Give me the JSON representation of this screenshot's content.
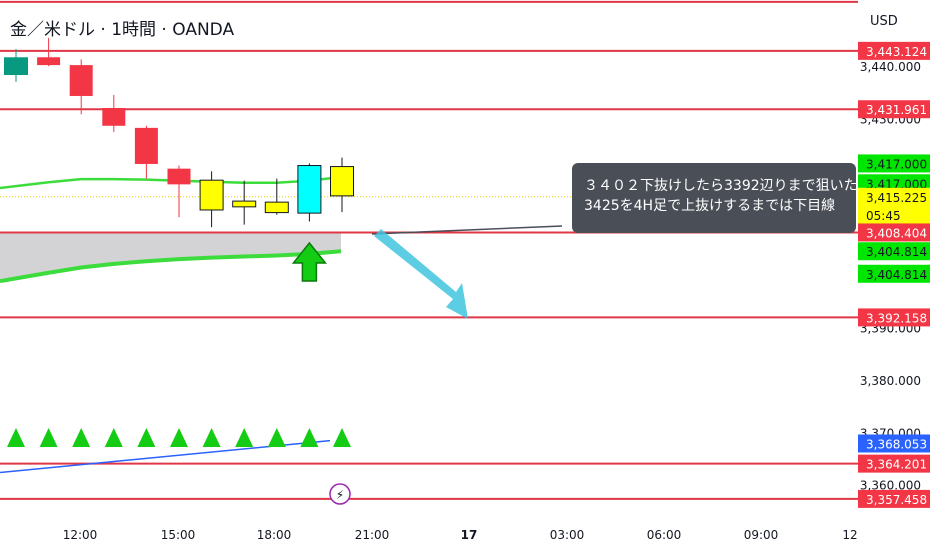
{
  "header": {
    "title": "金／米ドル · 1時間 · OANDA",
    "currency": "USD"
  },
  "annotation": {
    "line1": "３４０２下抜けしたら3392辺りまで狙いた",
    "line2": "3425を4H足で上抜けするまでは下目線"
  },
  "colors": {
    "bull": "#089981",
    "bear": "#f23645",
    "hline": "#e03746",
    "band_fill": "#d3d3d5",
    "band_line": "#3ddc3d",
    "up_marker": "#14cc14",
    "ma": "#2962ff",
    "arrow": "#40c4dd",
    "annotation_bg": "#4a4e57"
  },
  "chart_data": {
    "type": "candlestick",
    "price_axis": {
      "ticks": [
        "3,440.000",
        "3,430.000",
        "3,390.000",
        "3,380.000",
        "3,370.000",
        "3,360.000"
      ]
    },
    "time_axis": {
      "ticks": [
        "12:00",
        "15:00",
        "18:00",
        "21:00",
        "17",
        "03:00",
        "06:00",
        "09:00",
        "12"
      ]
    },
    "candles": [
      {
        "open": 3438.6,
        "high": 3443.5,
        "low": 3437.2,
        "close": 3441.8,
        "color": "teal"
      },
      {
        "open": 3441.9,
        "high": 3445.6,
        "low": 3440.2,
        "close": 3440.4,
        "color": "red"
      },
      {
        "open": 3440.4,
        "high": 3441.5,
        "low": 3431.0,
        "close": 3434.5,
        "color": "red"
      },
      {
        "open": 3432.2,
        "high": 3434.7,
        "low": 3427.6,
        "close": 3428.8,
        "color": "red"
      },
      {
        "open": 3428.4,
        "high": 3428.8,
        "low": 3418.7,
        "close": 3421.5,
        "color": "red"
      },
      {
        "open": 3420.6,
        "high": 3421.2,
        "low": 3411.3,
        "close": 3417.6,
        "color": "red"
      },
      {
        "open": 3418.4,
        "high": 3420.1,
        "low": 3409.4,
        "close": 3412.7,
        "color": "yellow"
      },
      {
        "open": 3414.4,
        "high": 3418.3,
        "low": 3409.9,
        "close": 3413.3,
        "color": "yellow"
      },
      {
        "open": 3414.2,
        "high": 3418.7,
        "low": 3411.8,
        "close": 3412.2,
        "color": "yellow"
      },
      {
        "open": 3421.2,
        "high": 3421.6,
        "low": 3410.5,
        "close": 3412.1,
        "color": "cyan"
      },
      {
        "open": 3415.4,
        "high": 3422.7,
        "low": 3412.3,
        "close": 3421.0,
        "color": "yellow"
      }
    ],
    "horizontal_lines": [
      3452.5,
      3443.124,
      3431.961,
      3408.404,
      3392.158,
      3364.201,
      3357.458
    ],
    "price_labels": [
      {
        "text": "3,443.124",
        "bg": "#f23645",
        "fg": "#ffffff",
        "price": 3443.124
      },
      {
        "text": "3,431.961",
        "bg": "#f23645",
        "fg": "#ffffff",
        "price": 3431.961
      },
      {
        "text": "3,417.000",
        "bg": "#00e600",
        "fg": "#131722",
        "price": 3421.6
      },
      {
        "text": "3,417.000",
        "bg": "#00e600",
        "fg": "#131722",
        "price": 3417.8
      },
      {
        "text": "3,415.225",
        "bg": "#ffff00",
        "fg": "#131722",
        "price": 3415.225,
        "countdown": "05:45"
      },
      {
        "text": "3,408.404",
        "bg": "#f23645",
        "fg": "#ffffff",
        "price": 3408.404
      },
      {
        "text": "3,404.814",
        "bg": "#00e600",
        "fg": "#131722",
        "price": 3404.814
      },
      {
        "text": "3,404.814",
        "bg": "#00e600",
        "fg": "#131722",
        "price": 3400.5
      },
      {
        "text": "3,392.158",
        "bg": "#f23645",
        "fg": "#ffffff",
        "price": 3392.158
      },
      {
        "text": "3,368.053",
        "bg": "#2962ff",
        "fg": "#ffffff",
        "price": 3368.053
      },
      {
        "text": "3,364.201",
        "bg": "#f23645",
        "fg": "#ffffff",
        "price": 3364.201
      },
      {
        "text": "3,357.458",
        "bg": "#f23645",
        "fg": "#ffffff",
        "price": 3357.458
      }
    ],
    "band": {
      "upper": [
        3416.9,
        3418.0,
        3418.6,
        3418.6,
        3418.5,
        3418.3,
        3418.1,
        3417.9,
        3417.9,
        3418.3,
        3419.0
      ],
      "lower": [
        3399.1,
        3400.7,
        3401.7,
        3402.4,
        3402.9,
        3403.3,
        3403.6,
        3403.8,
        3404.0,
        3404.3,
        3404.8
      ],
      "fill_top": 3408.404
    },
    "up_markers_count": 11,
    "ma_line": {
      "from": 3362.5,
      "to": 3368.6
    },
    "projection": {
      "from_price": 3408.4,
      "to_price": 3392.2
    }
  }
}
